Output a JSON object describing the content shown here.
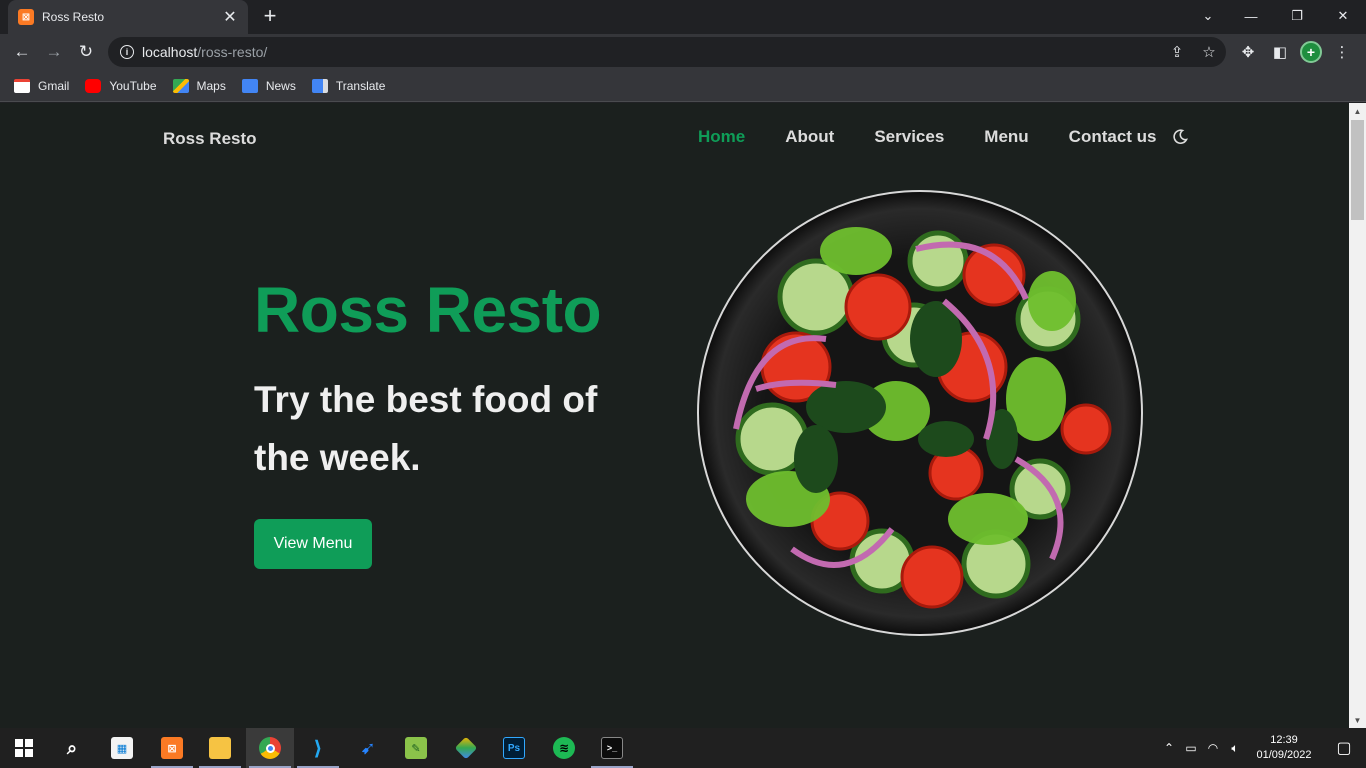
{
  "browser": {
    "tab_title": "Ross Resto",
    "url_host": "localhost",
    "url_path": "/ross-resto/",
    "bookmarks": [
      {
        "label": "Gmail",
        "icon": "gmail-icon",
        "color": "#ea4335"
      },
      {
        "label": "YouTube",
        "icon": "youtube-icon",
        "color": "#ff0000"
      },
      {
        "label": "Maps",
        "icon": "maps-icon",
        "color": "#34a853"
      },
      {
        "label": "News",
        "icon": "news-icon",
        "color": "#4285f4"
      },
      {
        "label": "Translate",
        "icon": "translate-icon",
        "color": "#4285f4"
      }
    ]
  },
  "site": {
    "brand": "Ross Resto",
    "nav": [
      "Home",
      "About",
      "Services",
      "Menu",
      "Contact us"
    ],
    "active_nav": "Home",
    "hero": {
      "title": "Ross Resto",
      "subtitle": "Try the best food of the week.",
      "cta": "View Menu"
    },
    "accent_color": "#0f9d58",
    "background_color": "#1b201e"
  },
  "taskbar": {
    "apps": [
      "start",
      "search",
      "store",
      "xampp",
      "file-explorer",
      "chrome",
      "vs-code",
      "sourcetree",
      "notepad",
      "git",
      "photoshop",
      "spotify",
      "terminal"
    ],
    "clock_time": "12:39",
    "clock_date": "01/09/2022"
  }
}
